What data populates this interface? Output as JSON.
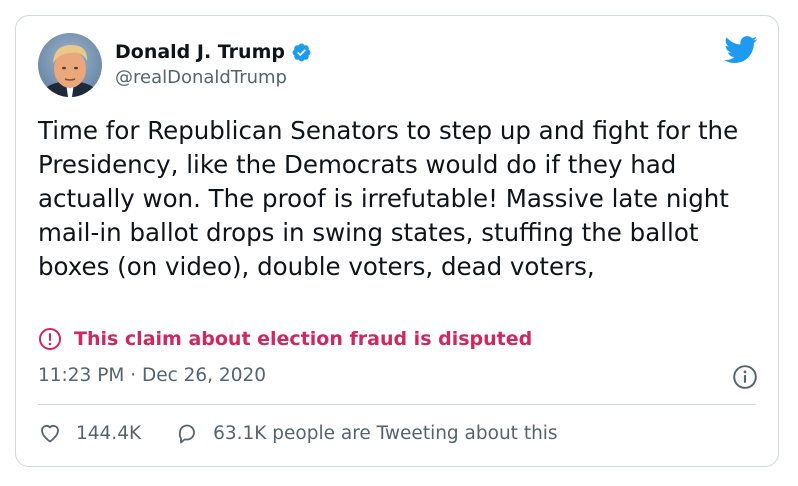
{
  "tweet": {
    "author_name": "Donald J. Trump",
    "author_handle": "@realDonaldTrump",
    "text": "Time for Republican Senators to step up and fight for the Presidency, like the Democrats would do if they had actually won. The proof is irrefutable! Massive late night mail-in ballot drops in swing states, stuffing the ballot boxes (on video), double voters, dead voters,",
    "disputed_label": "This claim about election fraud is disputed",
    "timestamp": "11:23 PM · Dec 26, 2020",
    "likes": "144.4K",
    "replies_label": "63.1K people are Tweeting about this"
  },
  "colors": {
    "accent": "#1d9bf0",
    "dispute": "#d0285e",
    "muted": "#536471",
    "border": "#cfd9de"
  },
  "icons": {
    "verified": "verified-badge-icon",
    "brand": "twitter-bird-icon",
    "warning": "exclamation-circle-icon",
    "info": "info-icon",
    "like": "heart-icon",
    "reply": "speech-bubble-icon"
  }
}
